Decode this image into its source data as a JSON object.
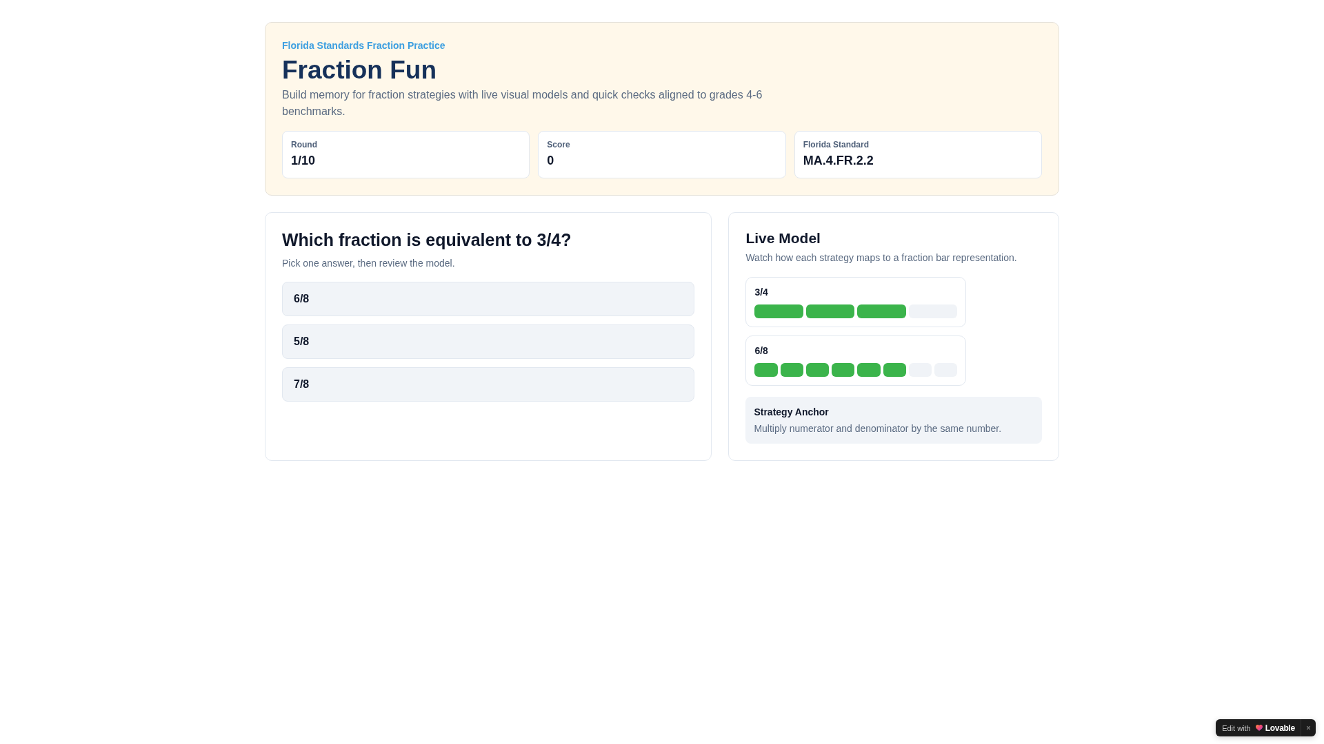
{
  "header": {
    "eyebrow": "Florida Standards Fraction Practice",
    "title": "Fraction Fun",
    "description": "Build memory for fraction strategies with live visual models and quick checks aligned to grades 4-6 benchmarks.",
    "stats": [
      {
        "label": "Round",
        "value": "1/10"
      },
      {
        "label": "Score",
        "value": "0"
      },
      {
        "label": "Florida Standard",
        "value": "MA.4.FR.2.2"
      }
    ]
  },
  "question": {
    "title": "Which fraction is equivalent to 3/4?",
    "hint": "Pick one answer, then review the model.",
    "options": [
      {
        "label": "6/8",
        "selected": false
      },
      {
        "label": "5/8",
        "selected": false
      },
      {
        "label": "7/8",
        "selected": false
      }
    ]
  },
  "live_model": {
    "title": "Live Model",
    "subtitle": "Watch how each strategy maps to a fraction bar representation.",
    "bars": [
      {
        "label": "3/4",
        "parts": [
          {
            "filled": true
          },
          {
            "filled": true
          },
          {
            "filled": true
          },
          {
            "filled": false
          }
        ]
      },
      {
        "label": "6/8",
        "parts": [
          {
            "filled": true
          },
          {
            "filled": true
          },
          {
            "filled": true
          },
          {
            "filled": true
          },
          {
            "filled": true
          },
          {
            "filled": true
          },
          {
            "filled": false
          },
          {
            "filled": false
          }
        ]
      }
    ],
    "strategy": {
      "title": "Strategy Anchor",
      "text": "Multiply numerator and denominator by the same number."
    }
  },
  "badge": {
    "prefix": "Edit with",
    "brand": "Lovable",
    "close": "×"
  }
}
